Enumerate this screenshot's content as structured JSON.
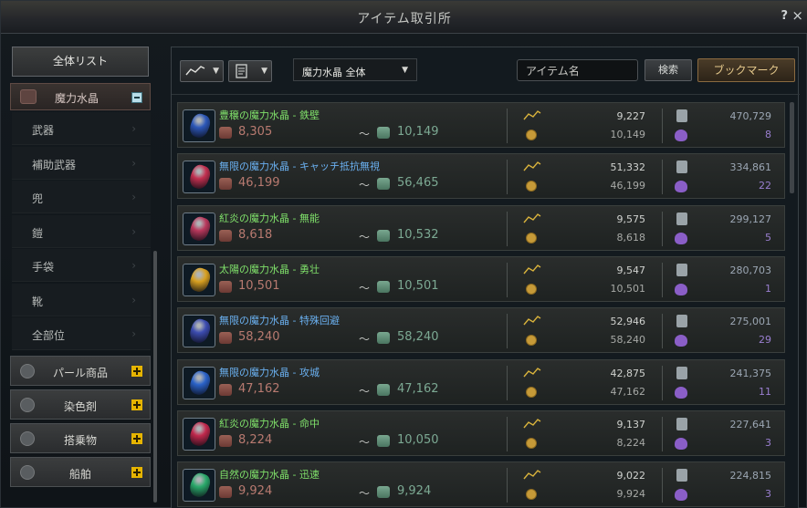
{
  "window": {
    "title": "アイテム取引所",
    "help": "?",
    "close": "×"
  },
  "sidebar": {
    "all_list": "全体リスト",
    "open_category": {
      "label": "魔力水晶",
      "icon": "crystal-icon"
    },
    "subitems": [
      "武器",
      "補助武器",
      "兜",
      "鎧",
      "手袋",
      "靴",
      "全部位"
    ],
    "groups": [
      {
        "label": "パール商品",
        "icon": "pearl-icon"
      },
      {
        "label": "染色剤",
        "icon": "dye-icon"
      },
      {
        "label": "搭乗物",
        "icon": "mount-icon"
      },
      {
        "label": "船舶",
        "icon": "ship-icon"
      }
    ]
  },
  "toolbar": {
    "chart_button_icon": "trend-icon",
    "list_button_icon": "list-icon",
    "filter_selected": "魔力水晶 全体",
    "search_value": "アイテム名",
    "search_button": "検索",
    "bookmark_button": "ブックマーク"
  },
  "items": [
    {
      "name": "豊穣の魔力水晶 - 鉄壁",
      "name_color": "#7fe06a",
      "gem_color": "#2c57b8",
      "min": "8,305",
      "max": "10,149",
      "recent": "9,227",
      "base": "10,149",
      "trades": "470,729",
      "stock": "8"
    },
    {
      "name": "無限の魔力水晶 - キャッチ抵抗無視",
      "name_color": "#6ab0f0",
      "gem_color": "#c23050",
      "min": "46,199",
      "max": "56,465",
      "recent": "51,332",
      "base": "46,199",
      "trades": "334,861",
      "stock": "22"
    },
    {
      "name": "紅炎の魔力水晶 - 無能",
      "name_color": "#7fe06a",
      "gem_color": "#b8385c",
      "min": "8,618",
      "max": "10,532",
      "recent": "9,575",
      "base": "8,618",
      "trades": "299,127",
      "stock": "5"
    },
    {
      "name": "太陽の魔力水晶 - 勇壮",
      "name_color": "#7fe06a",
      "gem_color": "#d8a020",
      "min": "10,501",
      "max": "10,501",
      "recent": "9,547",
      "base": "10,501",
      "trades": "280,703",
      "stock": "1"
    },
    {
      "name": "無限の魔力水晶 - 特殊回避",
      "name_color": "#6ab0f0",
      "gem_color": "#3c4cb0",
      "min": "58,240",
      "max": "58,240",
      "recent": "52,946",
      "base": "58,240",
      "trades": "275,001",
      "stock": "29"
    },
    {
      "name": "無限の魔力水晶 - 攻城",
      "name_color": "#6ab0f0",
      "gem_color": "#2a62c8",
      "min": "47,162",
      "max": "47,162",
      "recent": "42,875",
      "base": "47,162",
      "trades": "241,375",
      "stock": "11"
    },
    {
      "name": "紅炎の魔力水晶 - 命中",
      "name_color": "#7fe06a",
      "gem_color": "#c0284c",
      "min": "8,224",
      "max": "10,050",
      "recent": "9,137",
      "base": "8,224",
      "trades": "227,641",
      "stock": "3"
    },
    {
      "name": "自然の魔力水晶 - 迅速",
      "name_color": "#7fe06a",
      "gem_color": "#2aa86a",
      "min": "9,924",
      "max": "9,924",
      "recent": "9,022",
      "base": "9,924",
      "trades": "224,815",
      "stock": "3"
    }
  ]
}
